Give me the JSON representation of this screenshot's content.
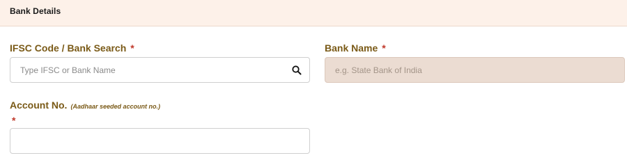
{
  "section": {
    "title": "Bank Details"
  },
  "ifsc": {
    "label": "IFSC Code / Bank Search",
    "required_mark": "*",
    "placeholder": "Type IFSC or Bank Name",
    "value": ""
  },
  "bank_name": {
    "label": "Bank Name",
    "required_mark": "*",
    "placeholder": "e.g. State Bank of India",
    "value": ""
  },
  "account": {
    "label": "Account No.",
    "hint": "(Aadhaar seeded account no.)",
    "required_mark": "*",
    "value": ""
  },
  "icons": {
    "search": "search-icon"
  },
  "colors": {
    "label": "#7a5a17",
    "required": "#c0392b",
    "header_bg": "#fdf1e9",
    "disabled_bg": "#ebdcd2"
  }
}
